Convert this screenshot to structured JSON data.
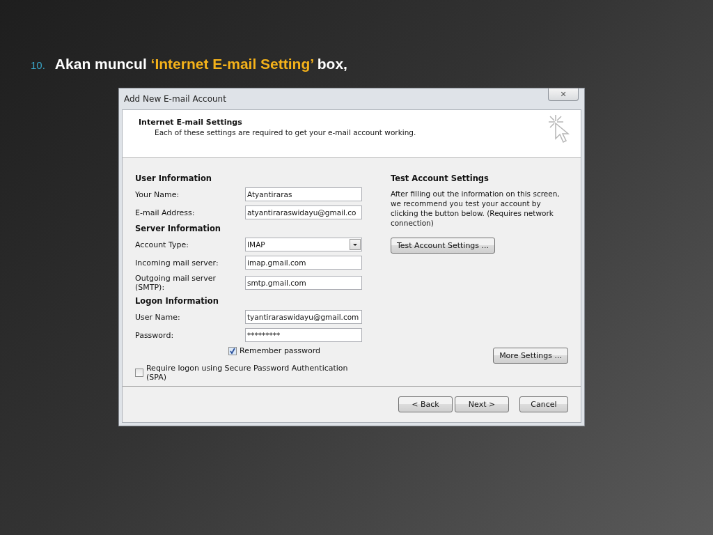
{
  "slide": {
    "number": "10.",
    "heading": [
      {
        "kind": "plain",
        "text": "Akan muncul "
      },
      {
        "kind": "highlight",
        "text": "‘Internet E-mail Setting’"
      },
      {
        "kind": "plain",
        "text": " box,"
      }
    ]
  },
  "dialog": {
    "title": "Add New E-mail Account",
    "close": "✕",
    "header": {
      "title": "Internet E-mail Settings",
      "subtitle": "Each of these settings are required to get your e-mail account working."
    },
    "sections": [
      {
        "title": "User Information",
        "fields": [
          {
            "kind": "text",
            "label": "Your Name:",
            "value": "Atyantiraras"
          },
          {
            "kind": "text",
            "label": "E-mail Address:",
            "value": "atyantiraraswidayu@gmail.co"
          }
        ]
      },
      {
        "title": "Server Information",
        "fields": [
          {
            "kind": "dropdown",
            "label": "Account Type:",
            "value": "IMAP"
          },
          {
            "kind": "text",
            "label": "Incoming mail server:",
            "value": "imap.gmail.com"
          },
          {
            "kind": "text",
            "label": "Outgoing mail server (SMTP):",
            "value": "smtp.gmail.com"
          }
        ]
      },
      {
        "title": "Logon Information",
        "fields": [
          {
            "kind": "text",
            "label": "User Name:",
            "value": "tyantiraraswidayu@gmail.com"
          },
          {
            "kind": "password",
            "label": "Password:",
            "value": "*********"
          }
        ]
      }
    ],
    "remember_password": {
      "label": "Remember password",
      "checked": true
    },
    "spa": {
      "label": "Require logon using Secure Password Authentication (SPA)",
      "checked": false
    },
    "test": {
      "title": "Test Account Settings",
      "description": "After filling out the information on this screen, we recommend you test your account by clicking the button below. (Requires network connection)",
      "button": "Test Account Settings ..."
    },
    "more_settings": "More Settings ...",
    "buttons": [
      "< Back",
      "Next >",
      "Cancel"
    ]
  }
}
